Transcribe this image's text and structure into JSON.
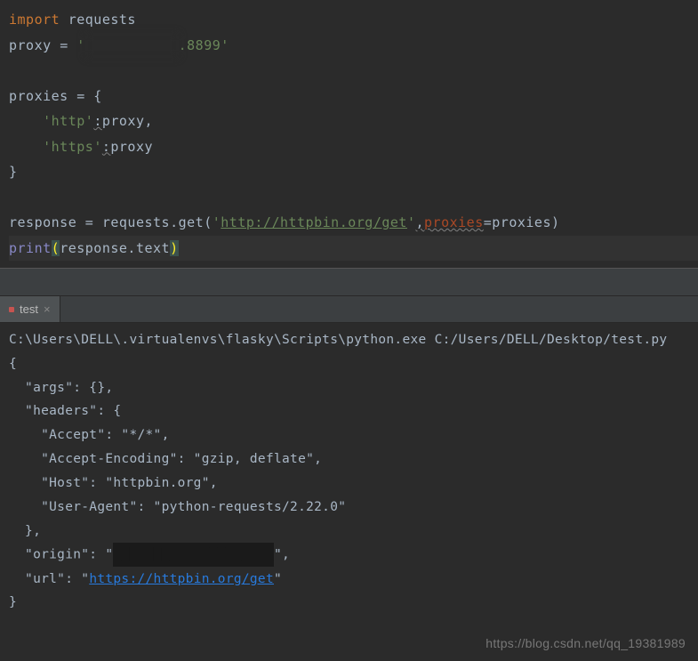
{
  "code": {
    "line1_kw": "import",
    "line1_mod": " requests",
    "line2_var": "proxy ",
    "line2_eq": "= ",
    "line2_str_q1": "'",
    "line2_str_redacted": "▇▇▇ ▇▇▇▇ ▇▇",
    "line2_str_end": ".8899",
    "line2_str_q2": "'",
    "line4_var": "proxies ",
    "line4_rest": "= {",
    "line5_indent": "    ",
    "line5_key_q": "'",
    "line5_key": "http",
    "line5_key_q2": "'",
    "line5_colon": ":",
    "line5_val": "proxy",
    "line5_comma": ",",
    "line6_indent": "    ",
    "line6_key_q": "'",
    "line6_key": "https",
    "line6_key_q2": "'",
    "line6_colon": ":",
    "line6_val": "proxy",
    "line7_close": "}",
    "line9_a": "response ",
    "line9_b": "= requests.get(",
    "line9_url_q1": "'",
    "line9_url": "http://httpbin.org/get",
    "line9_url_q2": "'",
    "line9_comma": ",",
    "line9_kw": "proxies",
    "line9_rest": "=proxies)",
    "line10_print": "print",
    "line10_lp": "(",
    "line10_arg": "response.text",
    "line10_rp": ")"
  },
  "tab": {
    "label": "test"
  },
  "console": {
    "line1": "C:\\Users\\DELL\\.virtualenvs\\flasky\\Scripts\\python.exe C:/Users/DELL/Desktop/test.py",
    "line2": "{",
    "line3": "  \"args\": {}, ",
    "line4": "  \"headers\": {",
    "line5": "    \"Accept\": \"*/*\", ",
    "line6": "    \"Accept-Encoding\": \"gzip, deflate\", ",
    "line7": "    \"Host\": \"httpbin.org\", ",
    "line8": "    \"User-Agent\": \"python-requests/2.22.0\"",
    "line9": "  }, ",
    "line10_a": "  \"origin\": \"",
    "line10_redacted": "▇▇▇ ▇▇▇▇ ▇ ▇▇▇▇▇ . ▇",
    "line10_c": "\", ",
    "line11_a": "  \"url\": \"",
    "line11_url": "https://httpbin.org/get",
    "line11_c": "\"",
    "line12": "}"
  },
  "watermark": "https://blog.csdn.net/qq_19381989"
}
